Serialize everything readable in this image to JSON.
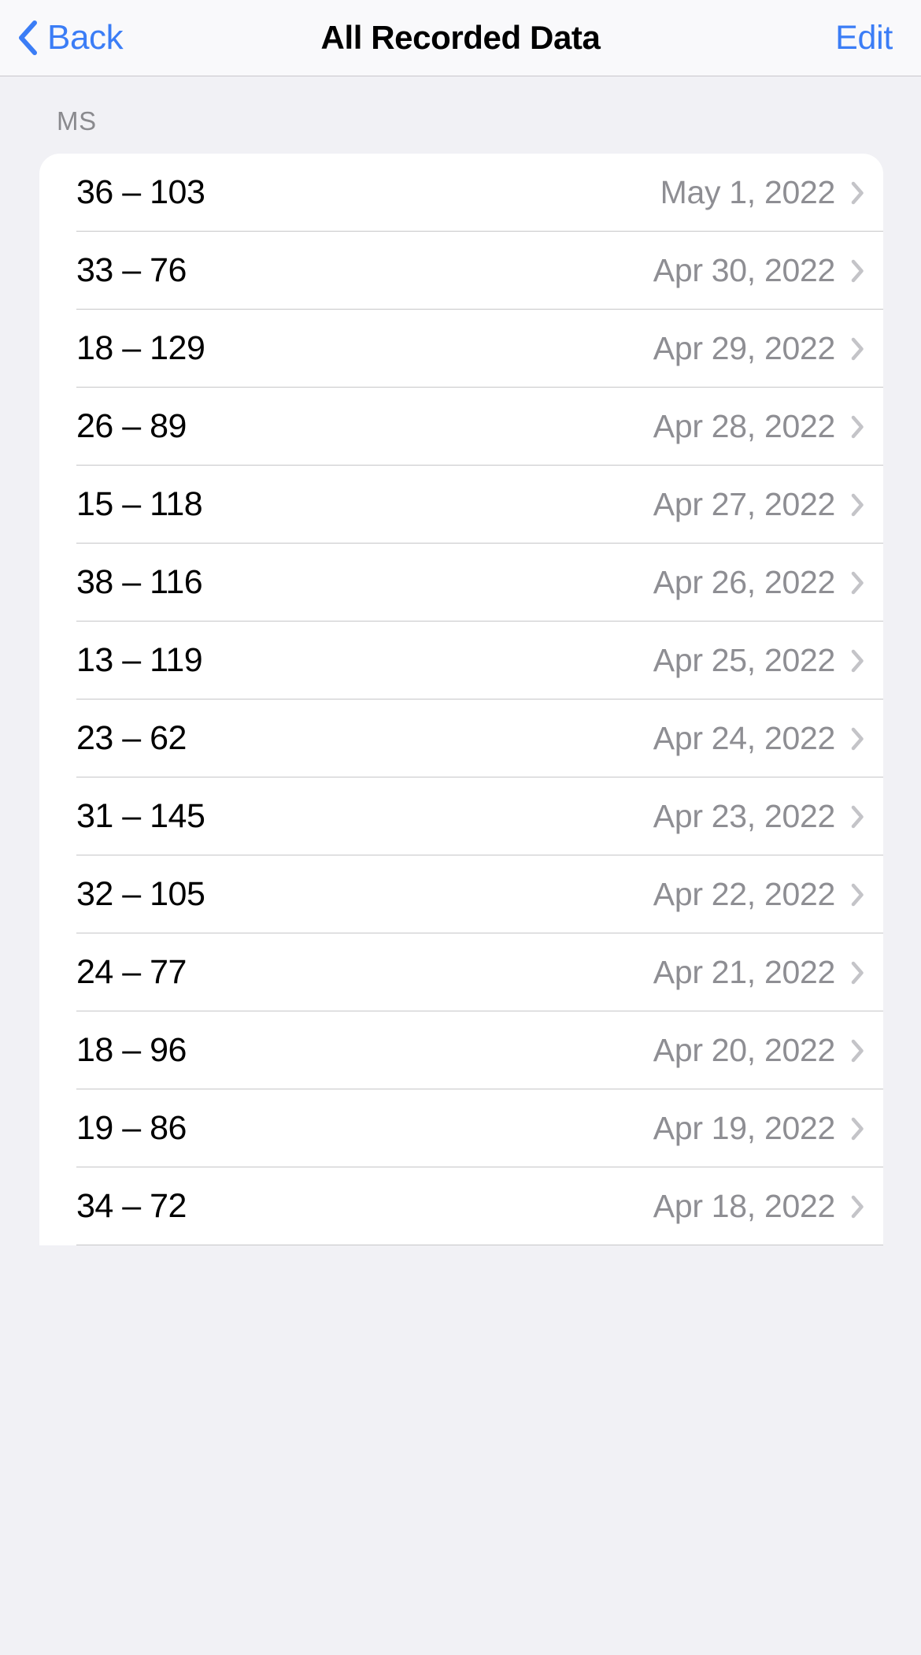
{
  "navbar": {
    "back_label": "Back",
    "title": "All Recorded Data",
    "edit_label": "Edit",
    "back_icon": "chevron-left-icon",
    "accent_color": "#3b7df6"
  },
  "section": {
    "header": "MS"
  },
  "list": {
    "disclosure_icon": "chevron-right-icon",
    "rows": [
      {
        "value": "36 – 103",
        "date": "May 1, 2022"
      },
      {
        "value": "33 – 76",
        "date": "Apr 30, 2022"
      },
      {
        "value": "18 – 129",
        "date": "Apr 29, 2022"
      },
      {
        "value": "26 – 89",
        "date": "Apr 28, 2022"
      },
      {
        "value": "15 – 118",
        "date": "Apr 27, 2022"
      },
      {
        "value": "38 – 116",
        "date": "Apr 26, 2022"
      },
      {
        "value": "13 – 119",
        "date": "Apr 25, 2022"
      },
      {
        "value": "23 – 62",
        "date": "Apr 24, 2022"
      },
      {
        "value": "31 – 145",
        "date": "Apr 23, 2022"
      },
      {
        "value": "32 – 105",
        "date": "Apr 22, 2022"
      },
      {
        "value": "24 – 77",
        "date": "Apr 21, 2022"
      },
      {
        "value": "18 – 96",
        "date": "Apr 20, 2022"
      },
      {
        "value": "19 – 86",
        "date": "Apr 19, 2022"
      },
      {
        "value": "34 – 72",
        "date": "Apr 18, 2022"
      }
    ]
  },
  "colors": {
    "background": "#f1f1f5",
    "navbar_background": "#f9f9fb",
    "card_background": "#ffffff",
    "secondary_text": "#8e8e93",
    "separator": "#c6c6c8",
    "chevron": "#c4c4c8"
  }
}
